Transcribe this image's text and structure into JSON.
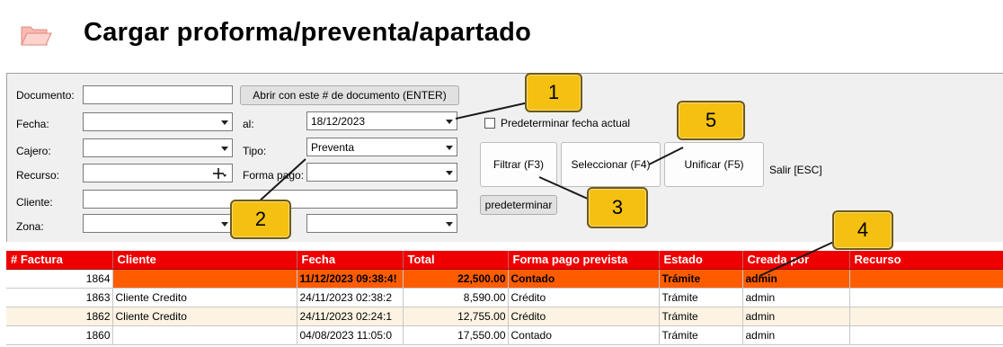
{
  "page": {
    "title": "Cargar proforma/preventa/apartado",
    "icon": "folder-open-icon"
  },
  "form": {
    "documento_label": "Documento:",
    "documento_value": "",
    "abrir_button": "Abrir con este # de documento (ENTER)",
    "fecha_label": "Fecha:",
    "fecha_value": "",
    "al_label": "al:",
    "al_value": "18/12/2023",
    "predeterminar_fecha_label": "Predeterminar fecha actual",
    "cajero_label": "Cajero:",
    "cajero_value": "",
    "tipo_label": "Tipo:",
    "tipo_value": "Preventa",
    "recurso_label": "Recurso:",
    "recurso_value": "",
    "forma_pago_label": "Forma pago:",
    "forma_pago_value": "",
    "cliente_label": "Cliente:",
    "cliente_value": "",
    "zona_label": "Zona:",
    "zona_value": "",
    "zona2_value": ""
  },
  "buttons": {
    "filtrar": "Filtrar (F3)",
    "seleccionar": "Seleccionar (F4)",
    "unificar": "Unificar (F5)",
    "salir": "Salir [ESC]",
    "predeterminar": "predeterminar"
  },
  "callouts": [
    "1",
    "2",
    "3",
    "4",
    "5"
  ],
  "table": {
    "headers": [
      "# Factura",
      "Cliente",
      "Fecha",
      "Total",
      "Forma pago prevista",
      "Estado",
      "Creada por",
      "Recurso"
    ],
    "rows": [
      {
        "factura": "1864",
        "cliente": "",
        "fecha": "11/12/2023 09:38:4!",
        "total": "22,500.00",
        "forma": "Contado",
        "estado": "Trámite",
        "creada": "admin",
        "recurso": ""
      },
      {
        "factura": "1863",
        "cliente": "Cliente Credito",
        "fecha": "24/11/2023 02:38:2",
        "total": "8,590.00",
        "forma": "Crédito",
        "estado": "Trámite",
        "creada": "admin",
        "recurso": ""
      },
      {
        "factura": "1862",
        "cliente": "Cliente Credito",
        "fecha": "24/11/2023 02:24:1",
        "total": "12,755.00",
        "forma": "Crédito",
        "estado": "Trámite",
        "creada": "admin",
        "recurso": ""
      },
      {
        "factura": "1860",
        "cliente": "",
        "fecha": "04/08/2023 11:05:0",
        "total": "17,550.00",
        "forma": "Contado",
        "estado": "Trámite",
        "creada": "admin",
        "recurso": ""
      }
    ]
  },
  "colors": {
    "header_red": "#ee0000",
    "selected_orange": "#ff5c00",
    "callout_yellow": "#f4c012"
  }
}
